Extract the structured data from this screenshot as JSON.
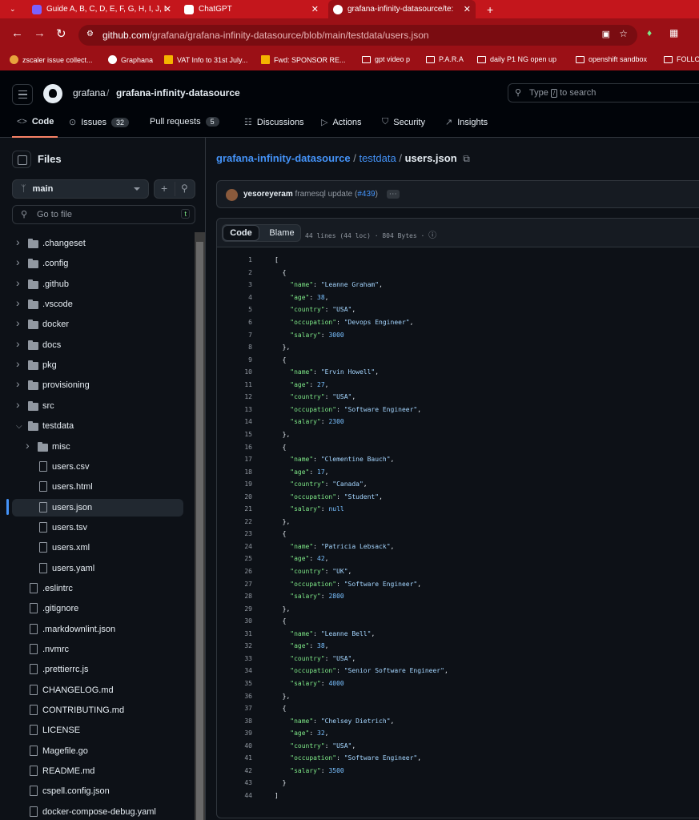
{
  "browser": {
    "tabs": [
      {
        "title": "Guide A, B, C, D, E, F, G, H, I, J, I",
        "active": false
      },
      {
        "title": "ChatGPT",
        "active": false
      },
      {
        "title": "grafana-infinity-datasource/te:",
        "active": true
      }
    ],
    "new_tab_symbol": "+",
    "url_host": "github.com",
    "url_path": "/grafana/grafana-infinity-datasource/blob/main/testdata/users.json",
    "bookmarks": [
      "zscaler issue collect...",
      "Graphana",
      "VAT Info to 31st July...",
      "Fwd: SPONSOR RE...",
      "gpt video p",
      "P.A.R.A",
      "daily P1 NG  open up",
      "openshift sandbox",
      "FOLLO"
    ],
    "theme_color": "#c4161c"
  },
  "header": {
    "owner": "grafana",
    "separator": "/",
    "repo": "grafana-infinity-datasource",
    "search_pre": "Type",
    "search_key": "/",
    "search_post": "to search",
    "nav": [
      {
        "label": "Code",
        "icon": "<>",
        "count": null
      },
      {
        "label": "Issues",
        "icon": "⊙",
        "count": "32"
      },
      {
        "label": "Pull requests",
        "icon": "⹽",
        "count": "5"
      },
      {
        "label": "Discussions",
        "icon": "☷",
        "count": null
      },
      {
        "label": "Actions",
        "icon": "▷",
        "count": null
      },
      {
        "label": "Security",
        "icon": "⛉",
        "count": null
      },
      {
        "label": "Insights",
        "icon": "↗",
        "count": null
      }
    ],
    "accent": "#f78166"
  },
  "sidebar": {
    "title": "Files",
    "branch": "main",
    "goto_placeholder": "Go to file",
    "goto_key": "t",
    "tree": [
      {
        "label": ".changeset",
        "type": "folder",
        "depth": 0,
        "expanded": false
      },
      {
        "label": ".config",
        "type": "folder",
        "depth": 0,
        "expanded": false
      },
      {
        "label": ".github",
        "type": "folder",
        "depth": 0,
        "expanded": false
      },
      {
        "label": ".vscode",
        "type": "folder",
        "depth": 0,
        "expanded": false
      },
      {
        "label": "docker",
        "type": "folder",
        "depth": 0,
        "expanded": false
      },
      {
        "label": "docs",
        "type": "folder",
        "depth": 0,
        "expanded": false
      },
      {
        "label": "pkg",
        "type": "folder",
        "depth": 0,
        "expanded": false
      },
      {
        "label": "provisioning",
        "type": "folder",
        "depth": 0,
        "expanded": false
      },
      {
        "label": "src",
        "type": "folder",
        "depth": 0,
        "expanded": false
      },
      {
        "label": "testdata",
        "type": "folder",
        "depth": 0,
        "expanded": true
      },
      {
        "label": "misc",
        "type": "folder",
        "depth": 1,
        "expanded": false
      },
      {
        "label": "users.csv",
        "type": "file",
        "depth": 1
      },
      {
        "label": "users.html",
        "type": "file",
        "depth": 1
      },
      {
        "label": "users.json",
        "type": "file",
        "depth": 1,
        "selected": true
      },
      {
        "label": "users.tsv",
        "type": "file",
        "depth": 1
      },
      {
        "label": "users.xml",
        "type": "file",
        "depth": 1
      },
      {
        "label": "users.yaml",
        "type": "file",
        "depth": 1
      },
      {
        "label": ".eslintrc",
        "type": "file",
        "depth": 0
      },
      {
        "label": ".gitignore",
        "type": "file",
        "depth": 0
      },
      {
        "label": ".markdownlint.json",
        "type": "file",
        "depth": 0
      },
      {
        "label": ".nvmrc",
        "type": "file",
        "depth": 0
      },
      {
        "label": ".prettierrc.js",
        "type": "file",
        "depth": 0
      },
      {
        "label": "CHANGELOG.md",
        "type": "file",
        "depth": 0
      },
      {
        "label": "CONTRIBUTING.md",
        "type": "file",
        "depth": 0
      },
      {
        "label": "LICENSE",
        "type": "file",
        "depth": 0
      },
      {
        "label": "Magefile.go",
        "type": "file",
        "depth": 0
      },
      {
        "label": "README.md",
        "type": "file",
        "depth": 0
      },
      {
        "label": "cspell.config.json",
        "type": "file",
        "depth": 0
      },
      {
        "label": "docker-compose-debug.yaml",
        "type": "file",
        "depth": 0
      }
    ]
  },
  "main": {
    "crumb_repo": "grafana-infinity-datasource",
    "crumb_folder": "testdata",
    "crumb_file": "users.json",
    "commit_author": "yesoreyeram",
    "commit_message": "framesql update (",
    "commit_pr": "#439",
    "commit_close": ")",
    "tab_code": "Code",
    "tab_blame": "Blame",
    "file_info": "44 lines (44 loc) · 804 Bytes ·",
    "records": [
      {
        "name": "Leanne Graham",
        "age": "38",
        "country": "USA",
        "occupation": "Devops Engineer",
        "salary": "3000"
      },
      {
        "name": "Ervin Howell",
        "age": "27",
        "country": "USA",
        "occupation": "Software Engineer",
        "salary": "2300"
      },
      {
        "name": "Clementine Bauch",
        "age": "17",
        "country": "Canada",
        "occupation": "Student",
        "salary": "null"
      },
      {
        "name": "Patricia Lebsack",
        "age": "42",
        "country": "UK",
        "occupation": "Software Engineer",
        "salary": "2800"
      },
      {
        "name": "Leanne Bell",
        "age": "38",
        "country": "USA",
        "occupation": "Senior Software Engineer",
        "salary": "4000"
      },
      {
        "name": "Chelsey Dietrich",
        "age": "32",
        "country": "USA",
        "occupation": "Software Engineer",
        "salary": "3500"
      }
    ]
  }
}
